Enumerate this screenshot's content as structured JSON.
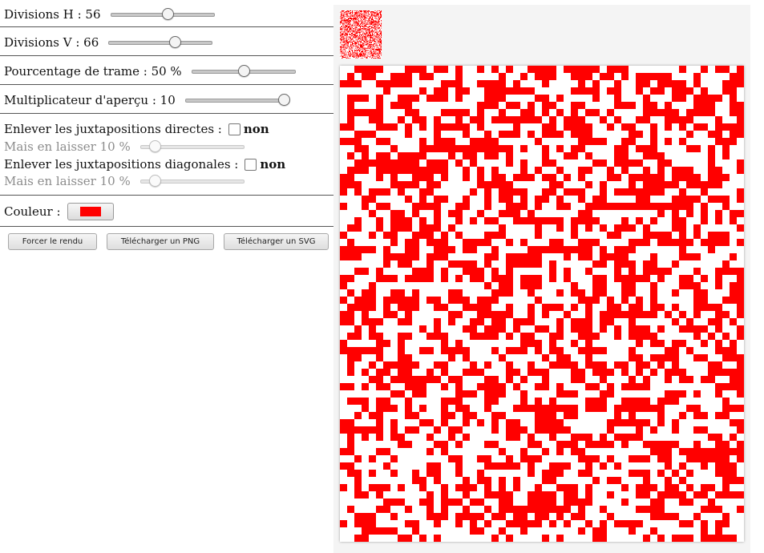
{
  "controls": {
    "divisions_h": {
      "label": "Divisions H : 56",
      "value": 56,
      "min": 1,
      "max": 100
    },
    "divisions_v": {
      "label": "Divisions V : 66",
      "value": 66,
      "min": 1,
      "max": 100
    },
    "pourcentage": {
      "label": "Pourcentage de trame : 50 %",
      "value": 50,
      "min": 0,
      "max": 100
    },
    "multiplicateur": {
      "label": "Multiplicateur d'aperçu : 10",
      "value": 10,
      "min": 1,
      "max": 10
    },
    "directes": {
      "label": "Enlever les juxtapositions directes :",
      "state_text": "non",
      "checked": false
    },
    "directes_leave": {
      "label": "Mais en laisser 10 %",
      "value": 10,
      "min": 0,
      "max": 100
    },
    "diagonales": {
      "label": "Enlever les juxtapositions diagonales :",
      "state_text": "non",
      "checked": false
    },
    "diagonales_leave": {
      "label": "Mais en laisser 10 %",
      "value": 10,
      "min": 0,
      "max": 100
    },
    "couleur": {
      "label": "Couleur :",
      "value": "#ff0000"
    }
  },
  "buttons": {
    "render": "Forcer le rendu",
    "png": "Télécharger un PNG",
    "svg": "Télécharger un SVG"
  },
  "pattern": {
    "cols": 56,
    "rows": 66,
    "fill_fraction": 0.5,
    "color": "#ff0000",
    "seed": 1337
  }
}
